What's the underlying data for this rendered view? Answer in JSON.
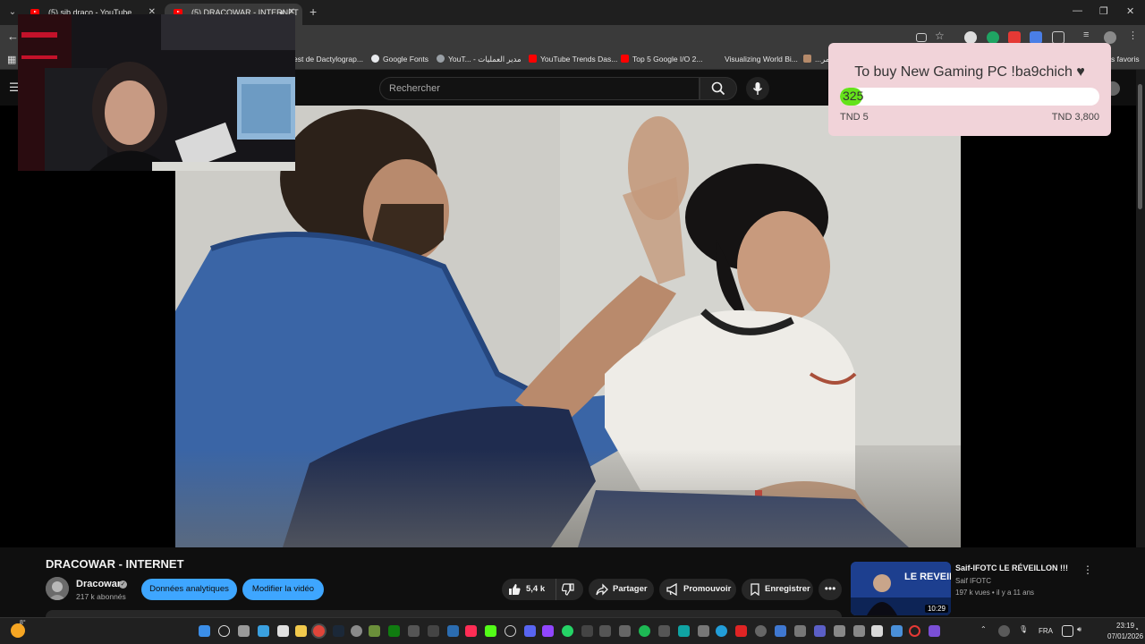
{
  "browser": {
    "tabs": [
      {
        "title": "(5) sib draco - YouTube",
        "active": false
      },
      {
        "title": "(5) DRACOWAR - INTERNET",
        "active": true
      }
    ],
    "bookmarks": [
      "est de Dactylograp...",
      "Google Fonts",
      "YouT... - مدير العمليات",
      "YouTube Trends Das...",
      "Top 5 Google I/O 2...",
      "Visualizing World Bi...",
      "...مر",
      "s favoris"
    ]
  },
  "youtube": {
    "search_placeholder": "Rechercher",
    "video_title": "DRACOWAR - INTERNET",
    "channel": {
      "name": "Dracowar",
      "verified_mark": "✓",
      "subscribers": "217 k abonnés"
    },
    "actions": {
      "analytics": "Données analytiques",
      "edit": "Modifier la vidéo",
      "likes": "5,4 k",
      "share": "Partager",
      "promote": "Promouvoir",
      "save": "Enregistrer",
      "more": "•••"
    },
    "related": {
      "title": "Saif-IFOTC LE RÉVEILLON !!!",
      "thumb_text": "LE REVEILLON",
      "channel": "Saif IFOTC",
      "meta": "197 k vues • il y a 11 ans",
      "duration": "10:29"
    }
  },
  "goal_widget": {
    "title": "To buy New Gaming PC !ba9chich ♥",
    "current": "325",
    "min_label": "TND 5",
    "max_label": "TND 3,800",
    "progress_fraction": 0.085,
    "fill_color": "#65e21a",
    "background_color": "#f1d3d9"
  },
  "taskbar": {
    "weather_temp": "8°",
    "language": "FRA",
    "time": "23:19",
    "date": "07/01/2026"
  }
}
